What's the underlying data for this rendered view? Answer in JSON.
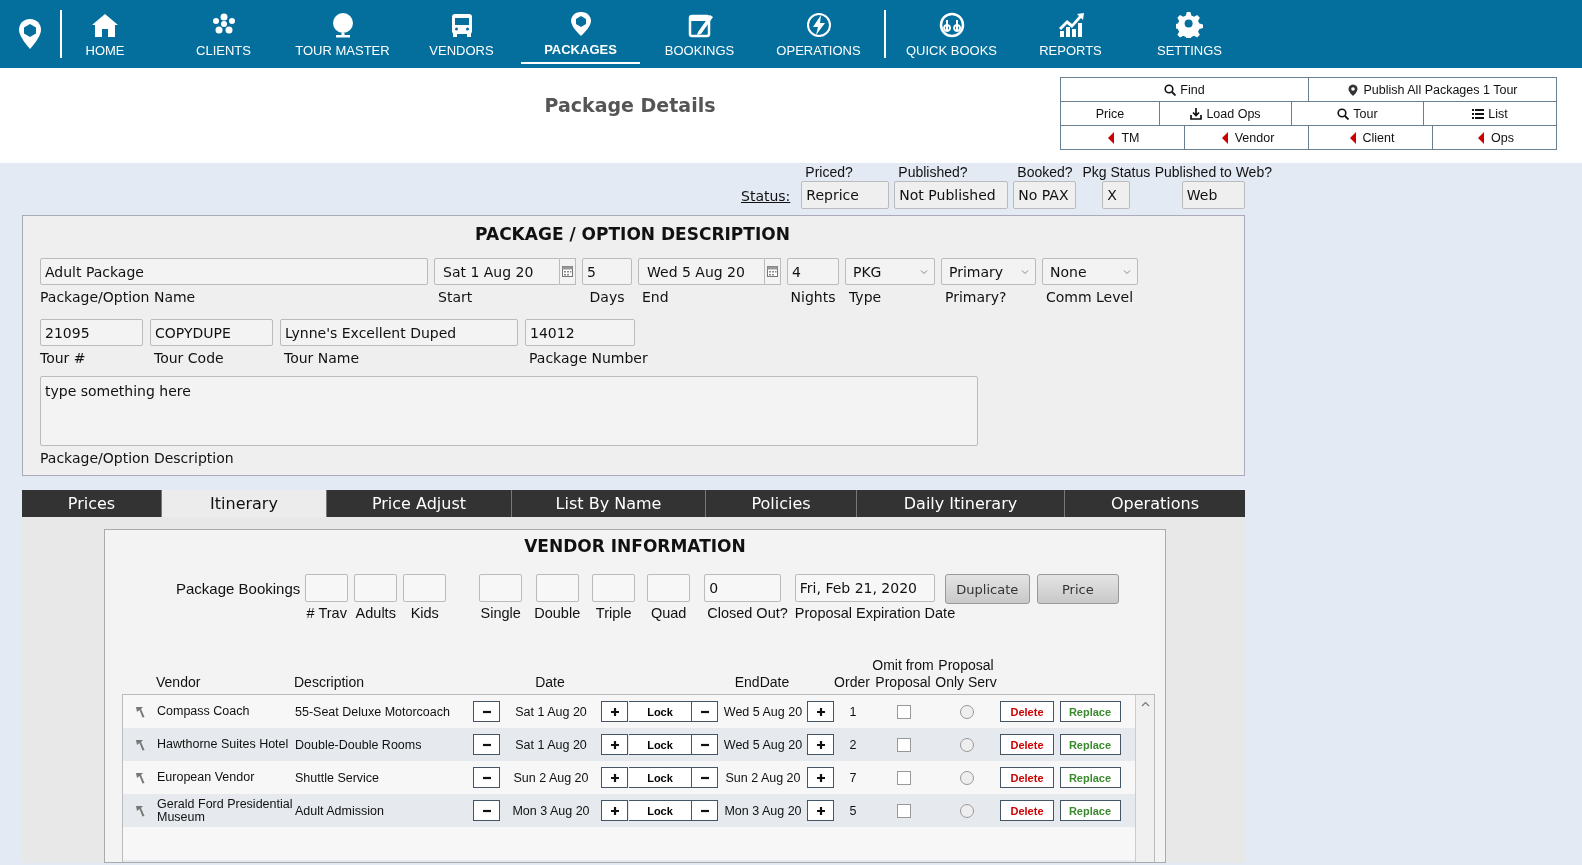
{
  "nav": {
    "items": [
      {
        "label": "HOME",
        "selected": false
      },
      {
        "label": "CLIENTS",
        "selected": false
      },
      {
        "label": "TOUR MASTER",
        "selected": false
      },
      {
        "label": "VENDORS",
        "selected": false
      },
      {
        "label": "PACKAGES",
        "selected": true
      },
      {
        "label": "BOOKINGS",
        "selected": false
      },
      {
        "label": "OPERATIONS",
        "selected": false
      },
      {
        "label": "QUICK BOOKS",
        "selected": false
      },
      {
        "label": "REPORTS",
        "selected": false
      },
      {
        "label": "SETTINGS",
        "selected": false
      }
    ]
  },
  "header": {
    "title": "Package Details"
  },
  "actions": [
    [
      {
        "label": "Find",
        "kind": "search"
      },
      {
        "label": "Publish All Packages 1 Tour",
        "kind": "pin"
      }
    ],
    [
      {
        "label": "Price",
        "kind": "plain"
      },
      {
        "label": "Load Ops",
        "kind": "download"
      },
      {
        "label": "Tour",
        "kind": "search"
      },
      {
        "label": "List",
        "kind": "list"
      }
    ],
    [
      {
        "label": "TM",
        "kind": "back"
      },
      {
        "label": "Vendor",
        "kind": "back"
      },
      {
        "label": "Client",
        "kind": "back"
      },
      {
        "label": "Ops",
        "kind": "back"
      }
    ]
  ],
  "status": {
    "label": "Status:",
    "fields": [
      {
        "label": "Priced?",
        "value": "Reprice"
      },
      {
        "label": "Published?",
        "value": "Not Published"
      },
      {
        "label": "Booked?",
        "value": "No PAX"
      },
      {
        "label": "Pkg Status",
        "value": "X"
      },
      {
        "label": "Published to Web?",
        "value": "Web"
      }
    ]
  },
  "package": {
    "title": "PACKAGE / OPTION DESCRIPTION",
    "name_row": [
      {
        "label": "Package/Option Name",
        "value": "Adult Package",
        "kind": "text"
      },
      {
        "label": "Start",
        "value": "Sat 1 Aug 20",
        "kind": "date"
      },
      {
        "label": "Days",
        "value": "5",
        "kind": "text"
      },
      {
        "label": "End",
        "value": "Wed 5 Aug 20",
        "kind": "date"
      },
      {
        "label": "Nights",
        "value": "4",
        "kind": "text"
      },
      {
        "label": "Type",
        "value": "PKG",
        "kind": "select"
      },
      {
        "label": "Primary?",
        "value": "Primary",
        "kind": "select"
      },
      {
        "label": "Comm Level",
        "value": "None",
        "kind": "select"
      }
    ],
    "tour_row": [
      {
        "label": "Tour #",
        "value": "21095",
        "kind": "text"
      },
      {
        "label": "Tour Code",
        "value": "COPYDUPE",
        "kind": "text"
      },
      {
        "label": "Tour Name",
        "value": "Lynne's Excellent Duped",
        "kind": "text"
      },
      {
        "label": "Package Number",
        "value": "14012",
        "kind": "text"
      }
    ],
    "description": {
      "label": "Package/Option Description",
      "value": "type something here"
    }
  },
  "tabs": [
    {
      "label": "Prices",
      "selected": false
    },
    {
      "label": "Itinerary",
      "selected": true
    },
    {
      "label": "Price Adjust",
      "selected": false
    },
    {
      "label": "List By Name",
      "selected": false
    },
    {
      "label": "Policies",
      "selected": false
    },
    {
      "label": "Daily Itinerary",
      "selected": false
    },
    {
      "label": "Operations",
      "selected": false
    }
  ],
  "vendor_info": {
    "title": "VENDOR INFORMATION",
    "bookings_label": "Package Bookings",
    "fields": [
      {
        "label": "# Trav",
        "kind": "count"
      },
      {
        "label": "Adults",
        "kind": "count"
      },
      {
        "label": "Kids",
        "kind": "count"
      },
      {
        "label": "Single",
        "kind": "room"
      },
      {
        "label": "Double",
        "kind": "room"
      },
      {
        "label": "Triple",
        "kind": "room"
      },
      {
        "label": "Quad",
        "kind": "room"
      },
      {
        "label": "Closed Out?",
        "value": "0",
        "kind": "closed"
      },
      {
        "label": "Proposal Expiration Date",
        "value": "Fri, Feb 21, 2020",
        "kind": "date"
      }
    ],
    "buttons": [
      "Duplicate",
      "Price"
    ],
    "table": {
      "columns": [
        "Vendor",
        "Description",
        "Date",
        "EndDate",
        "Order",
        "Omit from Proposal",
        "Proposal Only Serv"
      ],
      "rows": [
        {
          "vendor": "Compass Coach",
          "description": "55-Seat Deluxe Motorcoach",
          "date": "Sat 1 Aug 20",
          "lock": "Lock",
          "end_date": "Wed 5 Aug 20",
          "order": "1",
          "omit_from_proposal": {
            "checked": false
          },
          "proposal_only": {
            "selected": false
          },
          "delete": "Delete",
          "replace": "Replace"
        },
        {
          "vendor": "Hawthorne Suites Hotel",
          "description": "Double-Double Rooms",
          "date": "Sat 1 Aug 20",
          "lock": "Lock",
          "end_date": "Wed 5 Aug 20",
          "order": "2",
          "omit_from_proposal": {
            "checked": false
          },
          "proposal_only": {
            "selected": false
          },
          "delete": "Delete",
          "replace": "Replace"
        },
        {
          "vendor": "European Vendor",
          "description": "Shuttle Service",
          "date": "Sun 2 Aug 20",
          "lock": "Lock",
          "end_date": "Sun 2 Aug 20",
          "order": "7",
          "omit_from_proposal": {
            "checked": false
          },
          "proposal_only": {
            "selected": false
          },
          "delete": "Delete",
          "replace": "Replace"
        },
        {
          "vendor": "Gerald Ford Presidential Museum",
          "description": "Adult Admission",
          "date": "Mon 3 Aug 20",
          "lock": "Lock",
          "end_date": "Mon 3 Aug 20",
          "order": "5",
          "omit_from_proposal": {
            "checked": false
          },
          "proposal_only": {
            "selected": false
          },
          "delete": "Delete",
          "replace": "Replace"
        }
      ]
    }
  }
}
